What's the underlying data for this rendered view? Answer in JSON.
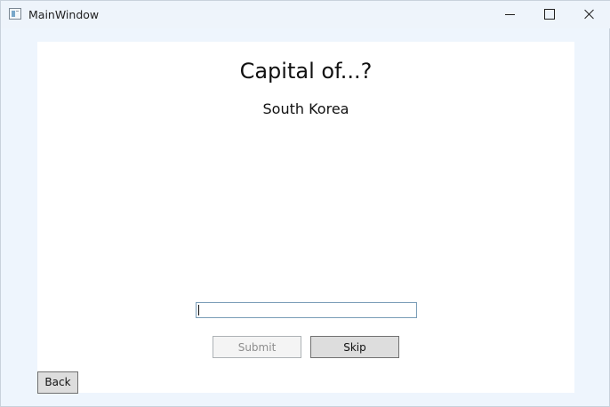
{
  "window": {
    "title": "MainWindow"
  },
  "quiz": {
    "heading": "Capital of...?",
    "country": "South Korea"
  },
  "answer_input": {
    "value": ""
  },
  "buttons": {
    "submit": "Submit",
    "skip": "Skip",
    "back": "Back"
  },
  "icons": {
    "app": "app-window-icon",
    "minimize": "minimize-icon",
    "maximize": "maximize-icon",
    "close": "close-icon"
  },
  "colors": {
    "window_background": "#eef5fd",
    "content_background": "#ffffff",
    "input_border": "#7a9db7",
    "disabled_text": "#8d8d8d"
  }
}
